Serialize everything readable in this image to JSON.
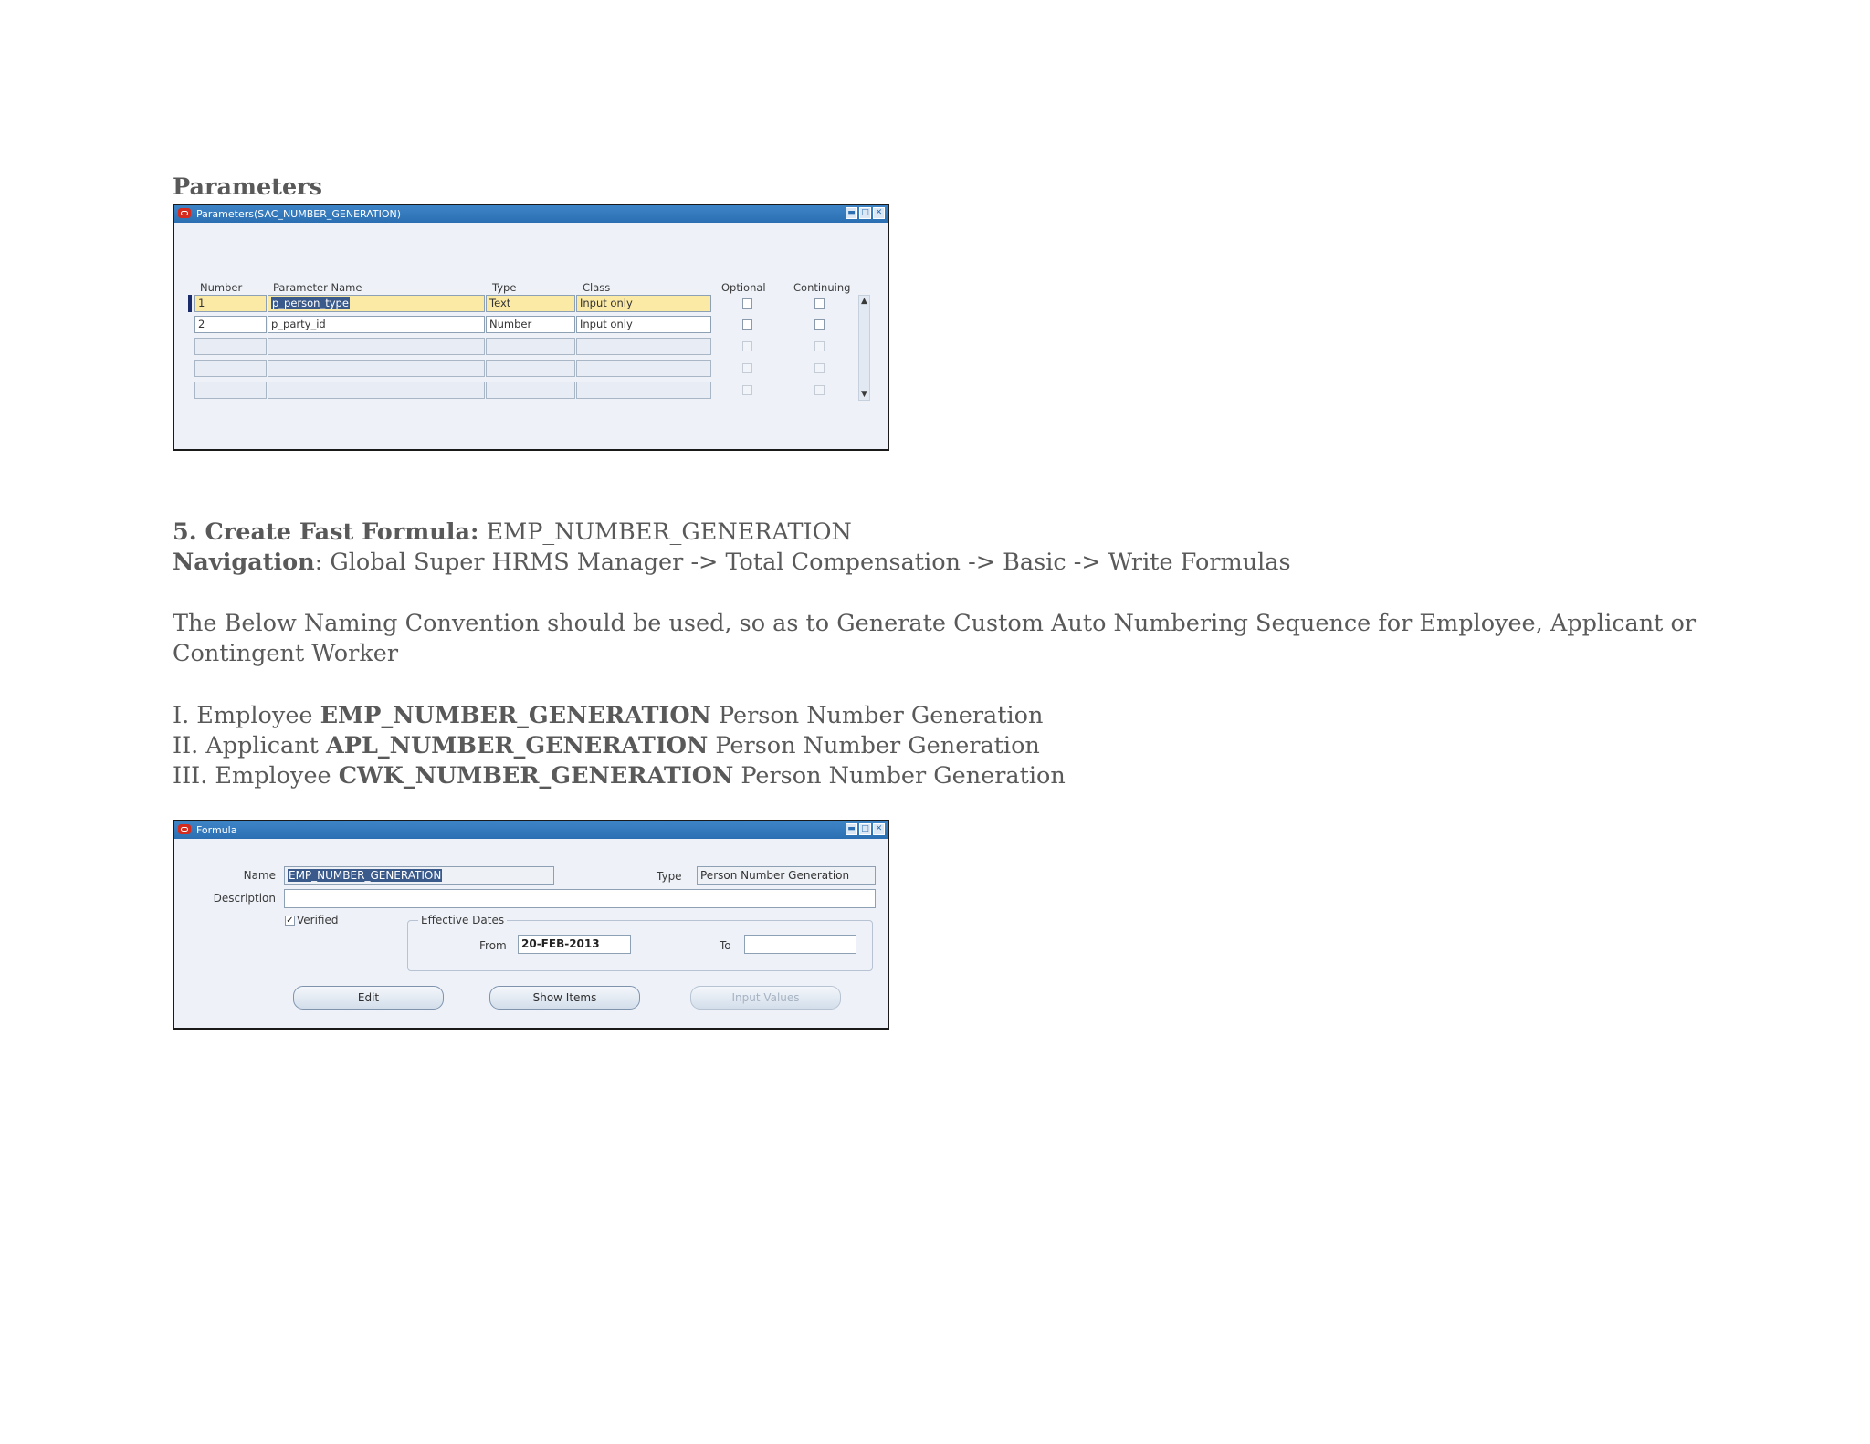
{
  "parameters_heading": "Parameters",
  "parameters_window": {
    "title": "Parameters(SAC_NUMBER_GENERATION)",
    "columns": {
      "number": "Number",
      "parameter_name": "Parameter Name",
      "type": "Type",
      "class": "Class",
      "optional": "Optional",
      "continuing": "Continuing"
    },
    "rows": [
      {
        "number": "1",
        "name": "p_person_type",
        "type": "Text",
        "class": "Input only"
      },
      {
        "number": "2",
        "name": "p_party_id",
        "type": "Number",
        "class": "Input only"
      }
    ]
  },
  "step5": {
    "label": "5. Create Fast Formula:",
    "value": " EMP_NUMBER_GENERATION",
    "nav_label": "Navigation",
    "nav_value": ": Global Super HRMS Manager -> Total Compensation -> Basic -> Write Formulas",
    "convention_line1": "The Below Naming Convention should be used, so as to Generate Custom Auto Numbering Sequence for Employee, Applicant or",
    "convention_line2": "Contingent Worker",
    "items": [
      {
        "prefix": "I. Employee ",
        "code": "EMP_NUMBER_GENERATION",
        "suffix": " Person Number Generation"
      },
      {
        "prefix": "II. Applicant ",
        "code": "APL_NUMBER_GENERATION",
        "suffix": " Person Number Generation"
      },
      {
        "prefix": "III. Employee ",
        "code": "CWK_NUMBER_GENERATION",
        "suffix": " Person Number Generation"
      }
    ]
  },
  "formula_window": {
    "title": "Formula",
    "name_label": "Name",
    "name_value": "EMP_NUMBER_GENERATION",
    "type_label": "Type",
    "type_value": "Person Number Generation",
    "description_label": "Description",
    "description_value": "",
    "verified_label": "Verified",
    "verified_checked": true,
    "effective_dates_label": "Effective Dates",
    "from_label": "From",
    "from_value": "20-FEB-2013",
    "to_label": "To",
    "to_value": "",
    "buttons": {
      "edit": "Edit",
      "show_items": "Show Items",
      "input_values": "Input Values"
    }
  },
  "colors": {
    "titlebar": "#2b6fb2",
    "current_row": "#fbeaa6",
    "selection": "#3a5a8c",
    "body_text": "#595959"
  }
}
